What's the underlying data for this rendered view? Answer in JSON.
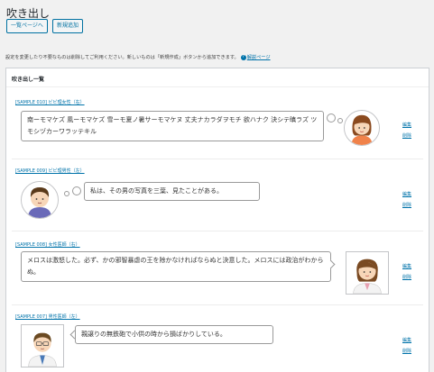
{
  "page": {
    "title": "吹き出し",
    "buttons": {
      "list": "一覧ページへ",
      "add_new": "新規追加"
    },
    "notice": {
      "text": "設定を変更したり不要なものは削除してご利用ください。新しいものは「新規作成」ボタンから追加できます。",
      "help_icon": "?",
      "help_link": "解説ページ"
    }
  },
  "panel": {
    "title": "吹き出し一覧"
  },
  "entries": [
    {
      "heading": "[SAMPLE 010] ビビ理女性（右）",
      "text": "南ーモマケズ 風ーモマケズ 雪ーモ夏ノ暑サーモマケヌ 丈夫ナカラダヲモチ 欲ハナク 決シテ瞋ラズ ツモシヅカーワラッテキル",
      "style": "think",
      "avatar": "woman-icon",
      "actions": [
        "編集",
        "削除"
      ]
    },
    {
      "heading": "[SAMPLE 009] ビビ理男性（左）",
      "text": "私は、その男の写真を三葉、見たことがある。",
      "style": "think",
      "avatar": "man-icon",
      "actions": [
        "編集",
        "削除"
      ]
    },
    {
      "heading": "[SAMPLE 008] 女性医師（右）",
      "text": "メロスは激怒した。必ず、かの邪智暴虐の王を除かなければならぬと決意した。メロスには政治がわからぬ。",
      "style": "speech",
      "avatar": "female-doctor-icon",
      "actions": [
        "編集",
        "削除"
      ]
    },
    {
      "heading": "[SAMPLE 007] 男性医師（左）",
      "text": "親譲りの無鉄砲で小供の時から損ばかりしている。",
      "style": "speech",
      "avatar": "male-doctor-icon",
      "actions": [
        "編集",
        "削除"
      ]
    }
  ],
  "colors": {
    "link": "#0073aa",
    "button_border": "#0071a1",
    "panel_border": "#ccd0d4",
    "background": "#f1f1f1"
  }
}
